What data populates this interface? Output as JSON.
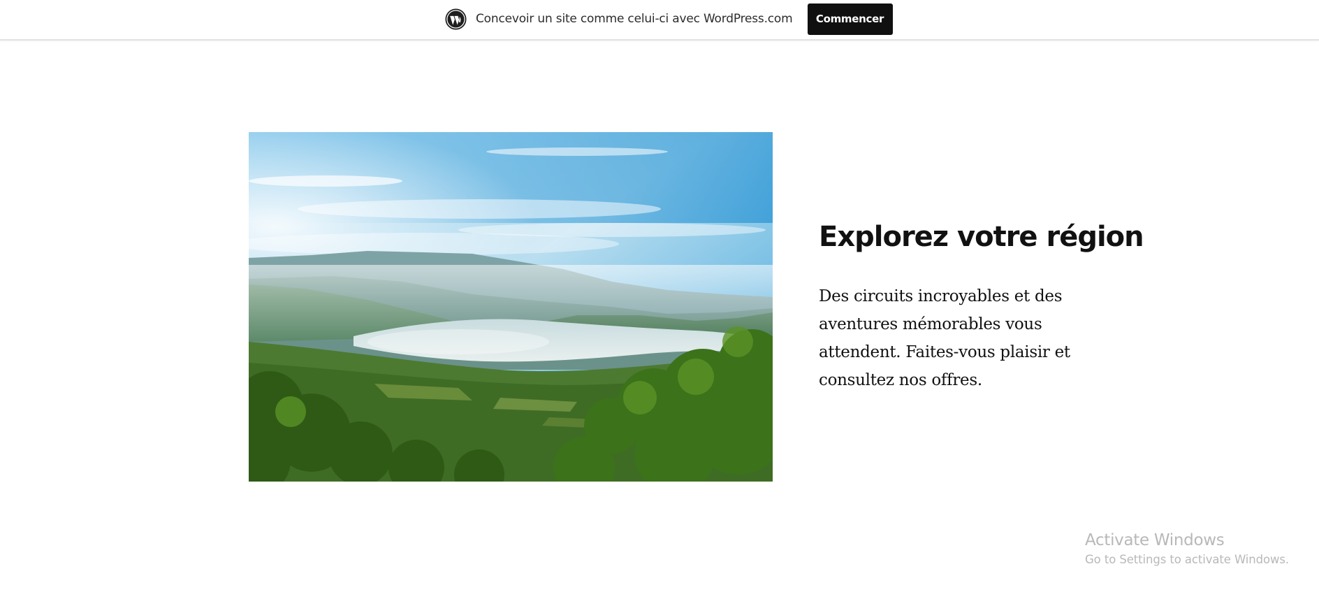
{
  "topbar": {
    "icon": "wordpress-logo-icon",
    "text": "Concevoir un site comme celui-ci avec WordPress.com",
    "button_label": "Commencer"
  },
  "hero": {
    "image": "landscape-photo",
    "heading": "Explorez votre région",
    "body": "Des circuits incroyables et des aventures mémorables vous attendent. Faites-vous plaisir et consultez nos offres."
  },
  "watermark": {
    "title": "Activate Windows",
    "subtitle": "Go to Settings to activate Windows."
  },
  "colors": {
    "button_bg": "#101010",
    "text": "#111111",
    "watermark": "#b8b8b8"
  }
}
